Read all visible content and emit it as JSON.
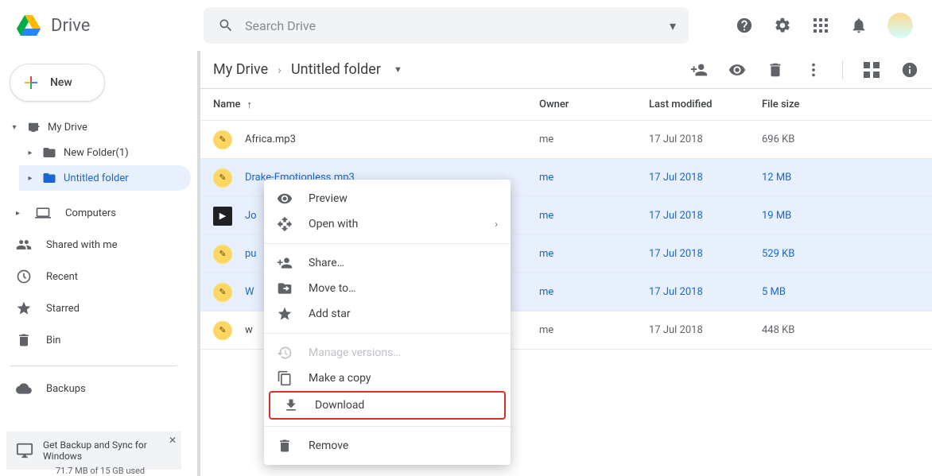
{
  "app": {
    "name": "Drive"
  },
  "search": {
    "placeholder": "Search Drive"
  },
  "newButton": {
    "label": "New"
  },
  "tree": {
    "myDrive": "My Drive",
    "children": [
      {
        "label": "New Folder(1)"
      },
      {
        "label": "Untitled folder"
      }
    ]
  },
  "sideLinks": {
    "computers": "Computers",
    "shared": "Shared with me",
    "recent": "Recent",
    "starred": "Starred",
    "bin": "Bin",
    "backups": "Backups"
  },
  "promo": {
    "text": "Get Backup and Sync for Windows"
  },
  "storage": "71.7 MB of 15 GB used",
  "breadcrumb": {
    "root": "My Drive",
    "folder": "Untitled folder"
  },
  "columns": {
    "name": "Name",
    "owner": "Owner",
    "modified": "Last modified",
    "size": "File size"
  },
  "files": [
    {
      "name": "Africa.mp3",
      "owner": "me",
      "modified": "17 Jul 2018",
      "size": "696 KB",
      "selected": false,
      "type": "audio"
    },
    {
      "name": "Drake-Emotionless.mp3",
      "owner": "me",
      "modified": "17 Jul 2018",
      "size": "12 MB",
      "selected": true,
      "type": "audio"
    },
    {
      "name": "Jo",
      "owner": "me",
      "modified": "17 Jul 2018",
      "size": "19 MB",
      "selected": true,
      "type": "video"
    },
    {
      "name": "pu",
      "owner": "me",
      "modified": "17 Jul 2018",
      "size": "529 KB",
      "selected": true,
      "type": "audio"
    },
    {
      "name": "W",
      "owner": "me",
      "modified": "17 Jul 2018",
      "size": "5 MB",
      "selected": true,
      "type": "audio"
    },
    {
      "name": "w",
      "owner": "me",
      "modified": "17 Jul 2018",
      "size": "448 KB",
      "selected": false,
      "type": "audio"
    }
  ],
  "contextMenu": {
    "preview": "Preview",
    "openWith": "Open with",
    "share": "Share…",
    "moveTo": "Move to…",
    "addStar": "Add star",
    "manageVersions": "Manage versions…",
    "makeCopy": "Make a copy",
    "download": "Download",
    "remove": "Remove"
  }
}
